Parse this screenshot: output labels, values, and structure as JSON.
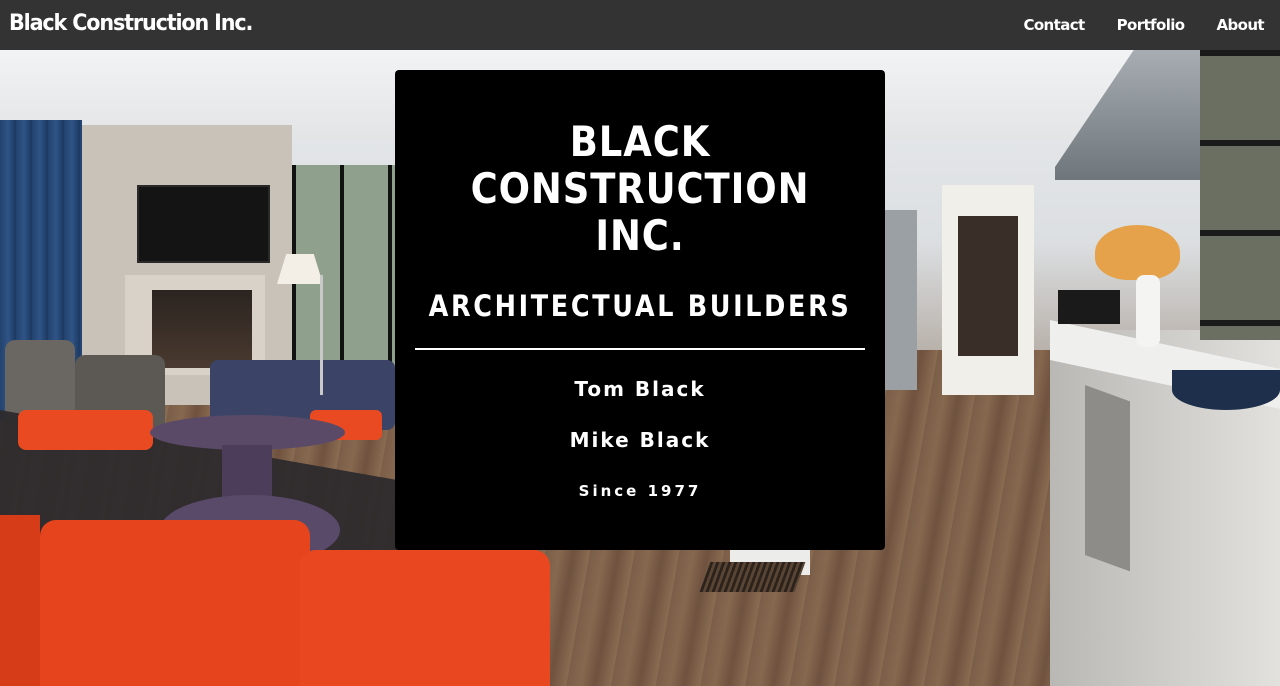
{
  "navbar": {
    "brand": "Black Construction Inc.",
    "links": [
      "Contact",
      "Portfolio",
      "About"
    ],
    "background_color": "#333333"
  },
  "hero": {
    "description_icon": "interior-photo"
  },
  "card": {
    "title_lines": [
      "BLACK",
      "CONSTRUCTION",
      "INC."
    ],
    "tagline": "ARCHITECTUAL BUILDERS",
    "owners": [
      "Tom Black",
      "Mike Black"
    ],
    "since": "Since 1977",
    "background_color": "#000000",
    "text_color": "#ffffff"
  }
}
